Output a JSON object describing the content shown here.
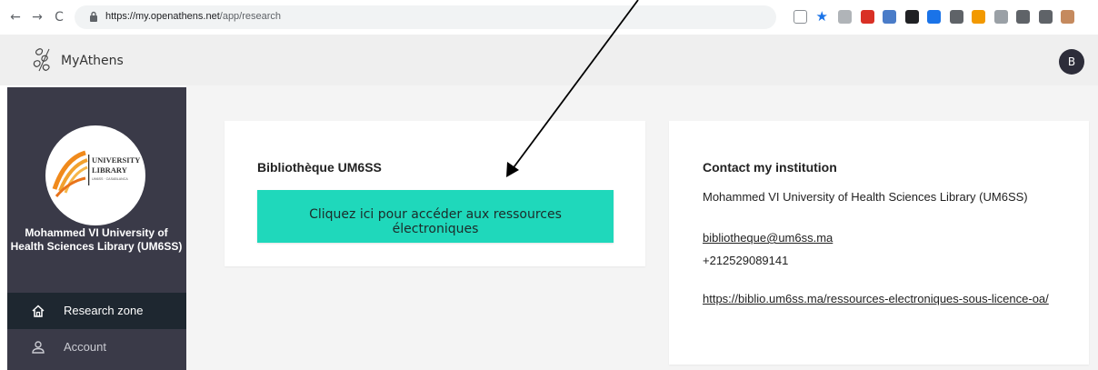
{
  "browser": {
    "url_host": "https://my.openathens.net",
    "url_path": "/app/research",
    "nav": {
      "back": "←",
      "forward": "→",
      "reload": "C"
    },
    "extensions": [
      {
        "name": "share-icon",
        "color": "#8a8f94"
      },
      {
        "name": "star-icon",
        "color": "#1a73e8"
      },
      {
        "name": "doc-icon",
        "color": "#b0b4b8"
      },
      {
        "name": "red-ext-icon",
        "color": "#d93025"
      },
      {
        "name": "blue-ext-icon",
        "color": "#4a7cc8"
      },
      {
        "name": "dark-ext-icon",
        "color": "#202124"
      },
      {
        "name": "shield-ext-icon",
        "color": "#1a73e8"
      },
      {
        "name": "list-ext-icon",
        "color": "#5f6368"
      },
      {
        "name": "orange-ext-icon",
        "color": "#f29900"
      },
      {
        "name": "gray-ext-icon",
        "color": "#9aa0a6"
      },
      {
        "name": "puzzle-icon",
        "color": "#5f6368"
      },
      {
        "name": "window-icon",
        "color": "#5f6368"
      },
      {
        "name": "profile-icon",
        "color": "#c58a5e"
      }
    ]
  },
  "header": {
    "brand": "MyAthens",
    "avatar_initial": "B"
  },
  "sidebar": {
    "logo_lines": [
      "UNIVERSITY",
      "LIBRARY",
      "UM6SS · CASABLANCA"
    ],
    "institution_name": "Mohammed VI University of Health Sciences Library (UM6SS)",
    "items": [
      {
        "label": "Research zone",
        "active": true,
        "icon": "home-icon"
      },
      {
        "label": "Account",
        "active": false,
        "icon": "user-icon"
      }
    ]
  },
  "library_card": {
    "title": "Bibliothèque UM6SS",
    "button_label": "Cliquez ici pour accéder aux ressources électroniques"
  },
  "contact_card": {
    "title": "Contact my institution",
    "institution": "Mohammed VI University of Health Sciences Library (UM6SS)",
    "email": "bibliotheque@um6ss.ma",
    "phone": "+212529089141",
    "website": "https://biblio.um6ss.ma/ressources-electroniques-sous-licence-oa/"
  },
  "colors": {
    "accent": "#1fd8bb",
    "sidebar": "#3a3a48",
    "sidebar_active": "#1e2730",
    "main_bg": "#f4f4f4"
  }
}
